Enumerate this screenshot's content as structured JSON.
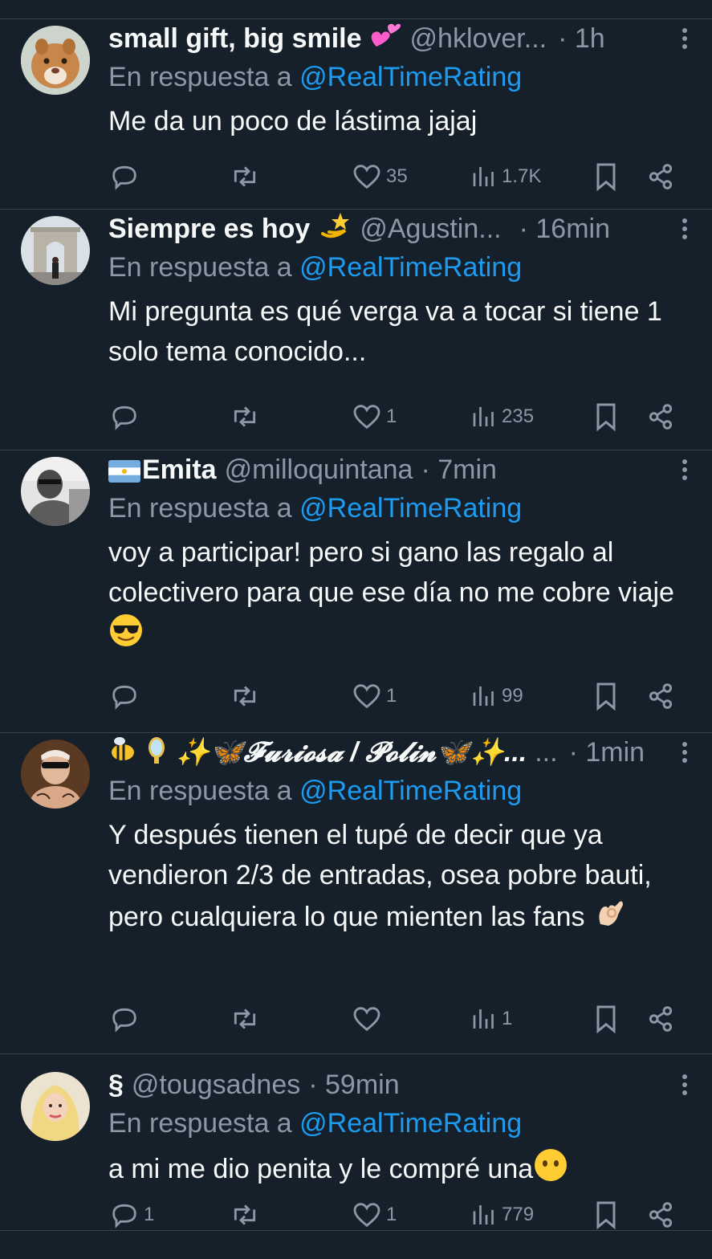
{
  "colors": {
    "background": "#15202b",
    "divider": "#38444d",
    "text": "#f7f9f9",
    "muted": "#8b98a5",
    "accent": "#1d9bf0"
  },
  "reply_prefix": "En respuesta a",
  "reply_target": "@RealTimeRating",
  "tweets": [
    {
      "name": "small gift, big smile",
      "name_emoji": "two-hearts",
      "handle": "@hklover...",
      "time": "· 1h",
      "text": "Me da un poco de lástima jajaj",
      "replies": "",
      "retweets": "",
      "likes": "35",
      "views": "1.7K"
    },
    {
      "name": "Siempre es hoy",
      "name_emoji": "dizzy-star",
      "handle": "@Agustin...",
      "time": "· 16min",
      "text": "Mi pregunta es qué verga va a tocar si tiene 1 solo tema conocido...",
      "replies": "",
      "retweets": "",
      "likes": "1",
      "views": "235"
    },
    {
      "name": "Emita",
      "name_emoji": "argentina-flag",
      "handle": "@milloquintana",
      "time": "· 7min",
      "text": "voy a participar! pero si gano las regalo al colectivero para que ese día no me cobre viaje",
      "text_emoji": "sunglasses-face",
      "replies": "",
      "retweets": "",
      "likes": "1",
      "views": "99"
    },
    {
      "name": "✨🦋𝓕𝓾𝓻𝓲𝓸𝓼𝓪 / 𝓟𝓸𝓵𝓲𝓷🦋✨...",
      "name_emoji": "bee-mirror",
      "handle": "...",
      "time": "· 1min",
      "text": "Y después tienen el tupé de decir que ya vendieron 2/3 de entradas, osea pobre bauti, pero cualquiera lo que mienten las fans",
      "text_emoji": "ok-hand",
      "replies": "",
      "retweets": "",
      "likes": "",
      "views": "1"
    },
    {
      "name": "§",
      "name_emoji": "",
      "handle": "@tougsadnes",
      "time": "· 59min",
      "text": "a mi me dio penita y le compré una",
      "text_emoji": "no-mouth-face",
      "replies": "1",
      "retweets": "",
      "likes": "1",
      "views": "779"
    }
  ]
}
